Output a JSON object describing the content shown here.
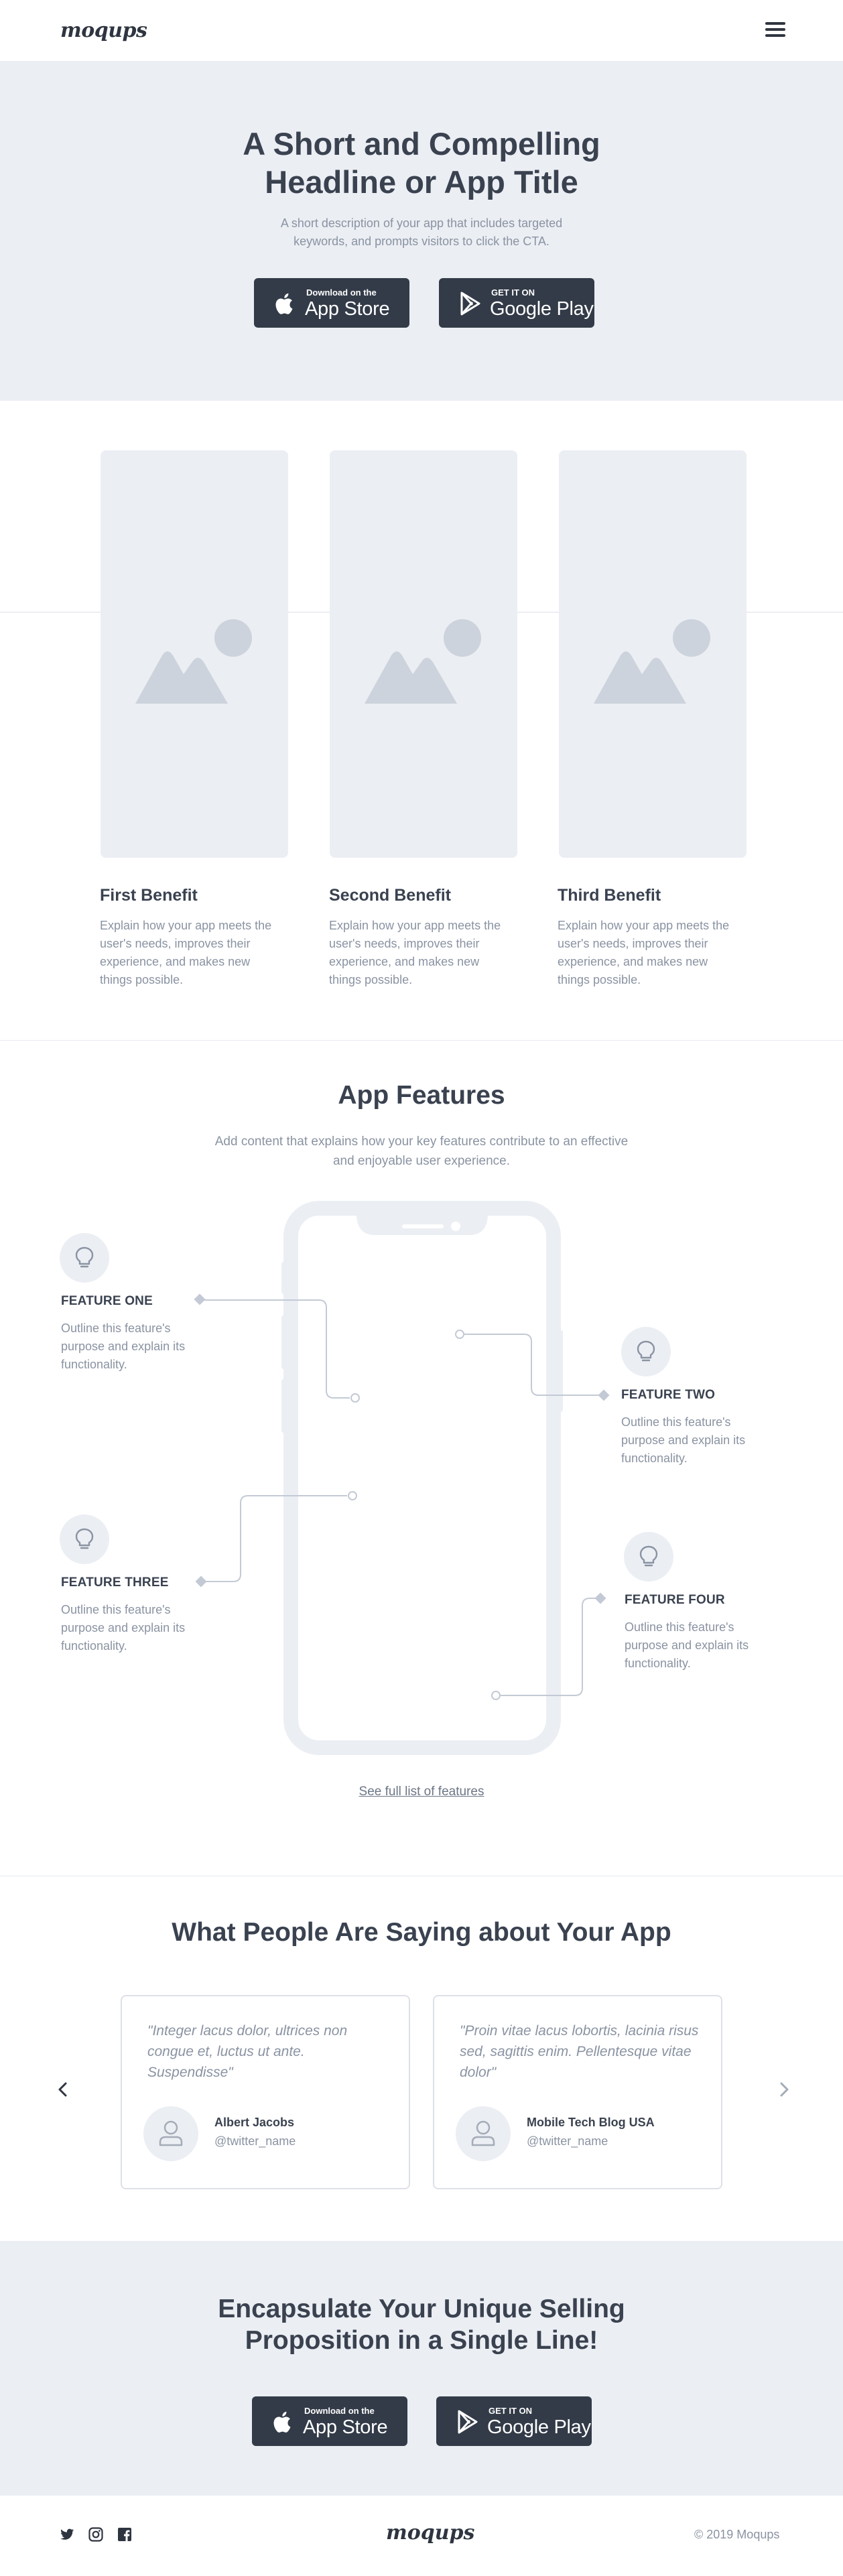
{
  "nav": {
    "logo": "moqups"
  },
  "hero": {
    "title_line1": "A Short and Compelling",
    "title_line2": "Headline or App Title",
    "desc_line1": "A short description of your app that includes targeted",
    "desc_line2": "keywords, and prompts visitors to click the CTA.",
    "appstore": {
      "small": "Download on the",
      "big": "App Store"
    },
    "googleplay": {
      "small": "GET IT ON",
      "big": "Google Play"
    }
  },
  "benefits": [
    {
      "title": "First Benefit",
      "desc": "Explain how your app meets the user's needs, improves their experience, and makes new things possible."
    },
    {
      "title": "Second Benefit",
      "desc": "Explain how your app meets the user's needs, improves their experience, and makes new things possible."
    },
    {
      "title": "Third Benefit",
      "desc": "Explain how your app meets the user's needs, improves their experience, and makes new things possible."
    }
  ],
  "features": {
    "title": "App Features",
    "desc_line1": "Add content that explains how your key features contribute to an effective",
    "desc_line2": "and enjoyable user experience.",
    "items": [
      {
        "title": "FEATURE ONE",
        "desc": "Outline this feature's purpose and explain its functionality."
      },
      {
        "title": "FEATURE TWO",
        "desc": "Outline this feature's purpose and explain its functionality."
      },
      {
        "title": "FEATURE THREE",
        "desc": "Outline this feature's purpose and explain its functionality."
      },
      {
        "title": "FEATURE FOUR",
        "desc": "Outline this feature's purpose and explain its functionality."
      }
    ],
    "link": "See full list of features"
  },
  "testimonials": {
    "title": "What People Are Saying about Your App",
    "items": [
      {
        "quote": "\"Integer lacus dolor, ultrices non congue et, luctus ut ante. Suspendisse\"",
        "name": "Albert Jacobs",
        "handle": "@twitter_name"
      },
      {
        "quote": "\"Proin vitae lacus lobortis, lacinia risus sed, sagittis enim. Pellentesque vitae dolor\"",
        "name": "Mobile Tech Blog USA",
        "handle": "@twitter_name"
      }
    ]
  },
  "cta": {
    "title_line1": "Encapsulate Your Unique Selling",
    "title_line2": "Proposition in a Single Line!"
  },
  "footer": {
    "logo": "moqups",
    "copyright": "© 2019  Moqups"
  },
  "colors": {
    "dark": "#333b48",
    "text": "#3a4250",
    "muted": "#8a93a2",
    "panel": "#ebeef3",
    "line": "#dde1e7"
  },
  "icons": [
    "hamburger-icon",
    "apple-icon",
    "google-play-icon",
    "image-placeholder-icon",
    "lightbulb-icon",
    "user-icon",
    "chevron-left-icon",
    "chevron-right-icon",
    "twitter-icon",
    "instagram-icon",
    "facebook-icon"
  ]
}
